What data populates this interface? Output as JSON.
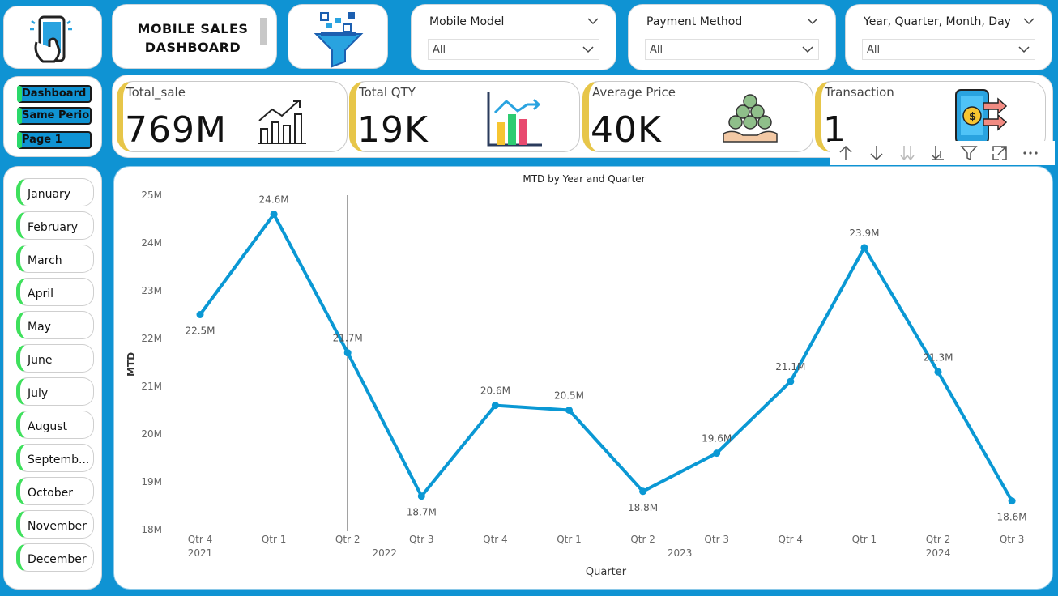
{
  "header": {
    "title_line1": "MOBILE SALES",
    "title_line2": "DASHBOARD"
  },
  "icons": {
    "logo": "phone-hand-icon",
    "filter": "funnel-filter-icon"
  },
  "slicers": {
    "model": {
      "label": "Mobile Model",
      "value": "All"
    },
    "payment": {
      "label": "Payment Method",
      "value": "All"
    },
    "date": {
      "label": "Year, Quarter, Month, Day",
      "value": "All"
    }
  },
  "nav": {
    "items": [
      "Dashboard",
      "Same Perio...",
      "Page 1"
    ]
  },
  "kpis": [
    {
      "name": "Total_sale",
      "value": "769M",
      "icon": "growth-chart-icon"
    },
    {
      "name": "Total QTY",
      "value": "19K",
      "icon": "bar-chart-icon"
    },
    {
      "name": "Average Price",
      "value": "40K",
      "icon": "money-stack-icon"
    },
    {
      "name": "Transaction",
      "value": "1",
      "icon": "phone-payment-icon"
    }
  ],
  "months": [
    "January",
    "February",
    "March",
    "April",
    "May",
    "June",
    "July",
    "August",
    "Septemb...",
    "October",
    "November",
    "December"
  ],
  "colors": {
    "background": "#0f93d3",
    "line": "#0a98d4",
    "month_accent": "#3ee05c",
    "kpi_accent": "#e7c649"
  },
  "chart_data": {
    "type": "line",
    "title": "MTD by Year and Quarter",
    "xlabel": "Quarter",
    "ylabel": "MTD",
    "ylim": [
      18,
      25
    ],
    "y_ticks": [
      "18M",
      "19M",
      "20M",
      "21M",
      "22M",
      "23M",
      "24M",
      "25M"
    ],
    "categories": [
      "Qtr 4",
      "Qtr 1",
      "Qtr 2",
      "Qtr 3",
      "Qtr 4",
      "Qtr 1",
      "Qtr 2",
      "Qtr 3",
      "Qtr 4",
      "Qtr 1",
      "Qtr 2",
      "Qtr 3"
    ],
    "year_groups": [
      {
        "label": "2021",
        "from": 0,
        "to": 0
      },
      {
        "label": "2022",
        "from": 1,
        "to": 4
      },
      {
        "label": "2023",
        "from": 5,
        "to": 8
      },
      {
        "label": "2024",
        "from": 9,
        "to": 11
      }
    ],
    "values": [
      22.5,
      24.6,
      21.7,
      18.7,
      20.6,
      20.5,
      18.8,
      19.6,
      21.1,
      23.9,
      21.3,
      18.6
    ],
    "data_labels": [
      "22.5M",
      "24.6M",
      "21.7M",
      "18.7M",
      "20.6M",
      "20.5M",
      "18.8M",
      "19.6M",
      "21.1M",
      "23.9M",
      "21.3M",
      "18.6M"
    ],
    "grid": false,
    "legend": "none"
  }
}
